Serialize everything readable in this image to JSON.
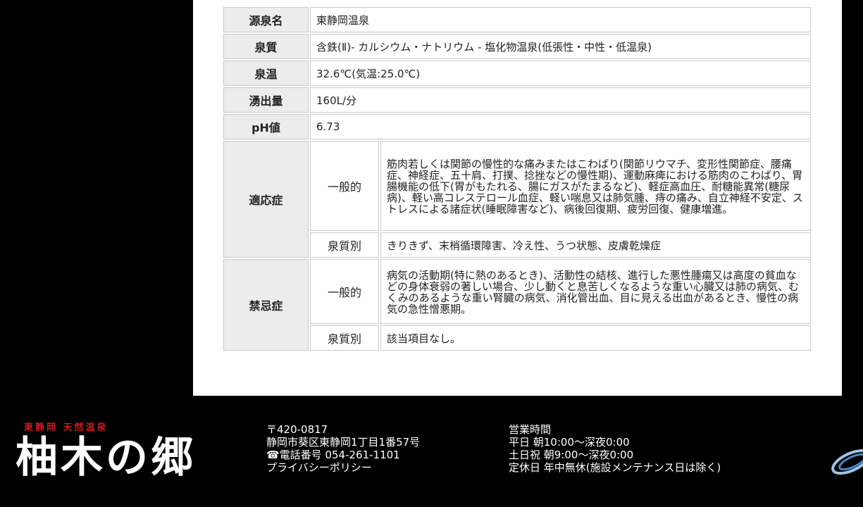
{
  "spa_table": {
    "rows": [
      {
        "label": "源泉名",
        "value": "東静岡温泉"
      },
      {
        "label": "泉質",
        "value": "含鉄(Ⅱ)- カルシウム・ナトリウム - 塩化物温泉(低張性・中性・低温泉)"
      },
      {
        "label": "泉温",
        "value": "32.6℃(気温:25.0℃)"
      },
      {
        "label": "湧出量",
        "value": "160L/分"
      },
      {
        "label": "pH値",
        "value": "6.73"
      }
    ],
    "indications": {
      "label": "適応症",
      "general_label": "一般的",
      "general_text": "筋肉若しくは関節の慢性的な痛みまたはこわばり(関節リウマチ、変形性関節症、腰痛症、神経症、五十肩、打撲、捻挫などの慢性期)、運動麻痺における筋肉のこわばり、胃腸機能の低下(胃がもたれる、腸にガスがたまるなど)、軽症高血圧、耐糖能異常(糖尿病)、軽い高コレステロール血症、軽い喘息又は肺気腫、痔の痛み、自立神経不安定、ストレスによる諸症状(睡眠障害など)、病後回復期、疲労回復、健康増進。",
      "by_quality_label": "泉質別",
      "by_quality_text": "きりきず、末梢循環障害、冷え性、うつ状態、皮膚乾燥症"
    },
    "contraindications": {
      "label": "禁忌症",
      "general_label": "一般的",
      "general_text": "病気の活動期(特に熱のあるとき)、活動性の結核、進行した悪性腫瘍又は高度の貧血などの身体衰弱の著しい場合、少し動くと息苦しくなるような重い心臓又は肺の病気、むくみのあるような重い腎臓の病気、消化管出血、目に見える出血があるとき、慢性の病気の急性憎悪期。",
      "by_quality_label": "泉質別",
      "by_quality_text": "該当項目なし。"
    }
  },
  "footer": {
    "tagline": "東静岡 天然温泉",
    "logo_text": "柚木の郷",
    "postal": "〒420-0817",
    "address": "静岡市葵区東静岡1丁目1番57号",
    "phone": "☎電話番号 054-261-1101",
    "privacy_link": "プライバシーポリシー",
    "hours_title": "営業時間",
    "weekday": "平日 朝10:00～深夜0:00",
    "weekend": "土日祝 朝9:00～深夜0:00",
    "holiday": "定休日 年中無休(施設メンテナンス日は除く)"
  },
  "colors": {
    "background": "#000000",
    "content_bg": "#ffffff",
    "header_cell": "#ececec",
    "tagline": "#d0191d"
  }
}
